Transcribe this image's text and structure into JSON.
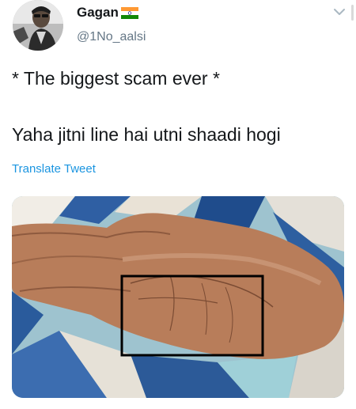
{
  "tweet": {
    "author": {
      "display_name": "Gagan",
      "handle": "@1No_aalsi",
      "avatar_icon": "avatar-photo",
      "flag_icon": "india-flag-emoji"
    },
    "menu_icon": "chevron-down-icon",
    "text_lines": [
      "* The biggest scam ever *",
      "Yaha jitni line hai utni shaadi hogi"
    ],
    "translate_label": "Translate Tweet",
    "media": {
      "description_icon": "palm-photo-with-black-rectangle"
    },
    "colors": {
      "link": "#1b95e0",
      "secondary_text": "#657786",
      "primary_text": "#14171a"
    }
  }
}
